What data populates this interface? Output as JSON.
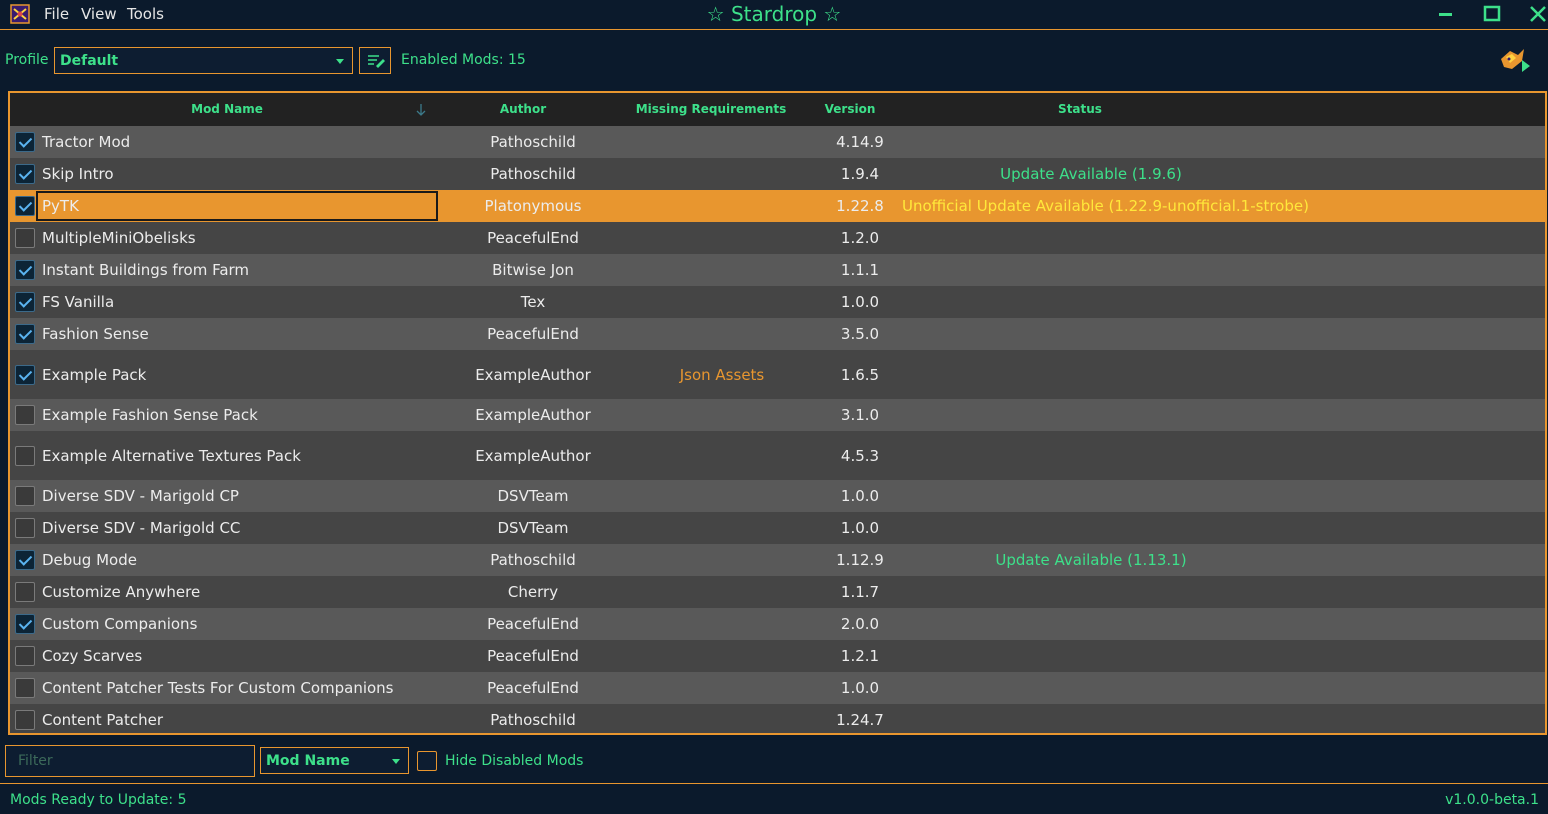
{
  "titlebar": {
    "title": "☆ Stardrop ☆",
    "menu": [
      "File",
      "View",
      "Tools"
    ],
    "buttons": [
      "minimize-icon",
      "maximize-icon",
      "close-icon"
    ]
  },
  "toolbar": {
    "profile_label": "Profile",
    "profile_value": "Default",
    "enabled_mods": "Enabled Mods: 15"
  },
  "grid": {
    "columns": [
      "Mod Name",
      "Author",
      "Missing Requirements",
      "Version",
      "Status"
    ],
    "rows": [
      {
        "checked": true,
        "name": "Tractor Mod",
        "author": "Pathoschild",
        "missing": "",
        "version": "4.14.9",
        "status": ""
      },
      {
        "checked": true,
        "name": "Skip Intro",
        "author": "Pathoschild",
        "missing": "",
        "version": "1.9.4",
        "status": "Update Available (1.9.6)"
      },
      {
        "checked": true,
        "name": "PyTK",
        "author": "Platonymous",
        "missing": "",
        "version": "1.22.8",
        "status": "Unofficial Update Available (1.22.9-unofficial.1-strobe)",
        "selected": true
      },
      {
        "checked": false,
        "name": "MultipleMiniObelisks",
        "author": "PeacefulEnd",
        "missing": "",
        "version": "1.2.0",
        "status": ""
      },
      {
        "checked": true,
        "name": "Instant Buildings from Farm",
        "author": "Bitwise Jon",
        "missing": "",
        "version": "1.1.1",
        "status": ""
      },
      {
        "checked": true,
        "name": "FS Vanilla",
        "author": "Tex",
        "missing": "",
        "version": "1.0.0",
        "status": ""
      },
      {
        "checked": true,
        "name": "Fashion Sense",
        "author": "PeacefulEnd",
        "missing": "",
        "version": "3.5.0",
        "status": ""
      },
      {
        "checked": true,
        "name": "Example Pack",
        "author": "ExampleAuthor",
        "missing": "Json Assets",
        "version": "1.6.5",
        "status": ""
      },
      {
        "checked": false,
        "name": "Example Fashion Sense Pack",
        "author": "ExampleAuthor",
        "missing": "",
        "version": "3.1.0",
        "status": ""
      },
      {
        "checked": false,
        "name": "Example Alternative Textures Pack",
        "author": "ExampleAuthor",
        "missing": "",
        "version": "4.5.3",
        "status": ""
      },
      {
        "checked": false,
        "name": "Diverse SDV - Marigold CP",
        "author": "DSVTeam",
        "missing": "",
        "version": "1.0.0",
        "status": ""
      },
      {
        "checked": false,
        "name": "Diverse SDV - Marigold CC",
        "author": "DSVTeam",
        "missing": "",
        "version": "1.0.0",
        "status": ""
      },
      {
        "checked": true,
        "name": "Debug Mode",
        "author": "Pathoschild",
        "missing": "",
        "version": "1.12.9",
        "status": "Update Available (1.13.1)"
      },
      {
        "checked": false,
        "name": "Customize Anywhere",
        "author": "Cherry",
        "missing": "",
        "version": "1.1.7",
        "status": ""
      },
      {
        "checked": true,
        "name": "Custom Companions",
        "author": "PeacefulEnd",
        "missing": "",
        "version": "2.0.0",
        "status": ""
      },
      {
        "checked": false,
        "name": "Cozy Scarves",
        "author": "PeacefulEnd",
        "missing": "",
        "version": "1.2.1",
        "status": ""
      },
      {
        "checked": false,
        "name": "Content Patcher Tests For Custom Companions",
        "author": "PeacefulEnd",
        "missing": "",
        "version": "1.0.0",
        "status": ""
      },
      {
        "checked": false,
        "name": "Content Patcher",
        "author": "Pathoschild",
        "missing": "",
        "version": "1.24.7",
        "status": ""
      }
    ]
  },
  "bottom": {
    "filter_placeholder": "Filter",
    "filter_column": "Mod Name",
    "hide_disabled_label": "Hide Disabled Mods"
  },
  "statusbar": {
    "left": "Mods Ready to Update: 5",
    "right": "v1.0.0-beta.1"
  },
  "colors": {
    "accent_orange": "#e8962f",
    "accent_green": "#3de08a",
    "background": "#0b1a2c",
    "status_yellow": "#ffe83a"
  }
}
